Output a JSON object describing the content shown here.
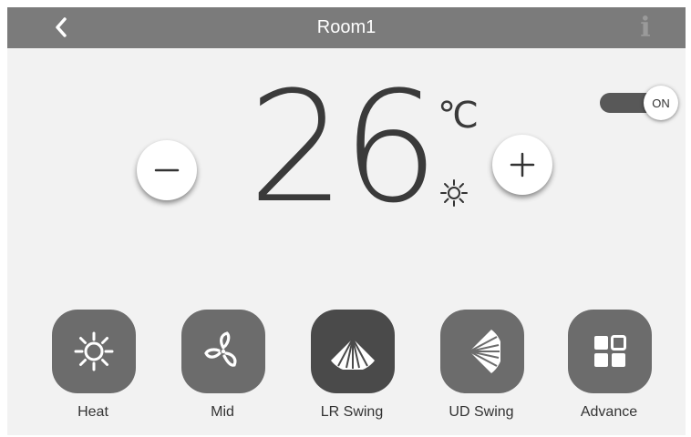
{
  "header": {
    "title": "Room1",
    "back_icon": "chevron-left-icon",
    "info_icon": "info-icon",
    "info_glyph": "i"
  },
  "temperature": {
    "value": "26",
    "unit": "℃",
    "mode_icon": "sun-icon"
  },
  "controls": {
    "decrease_icon": "minus-icon",
    "increase_icon": "plus-icon"
  },
  "power": {
    "label": "ON",
    "state": true
  },
  "functions": [
    {
      "label": "Heat",
      "icon": "sun-icon"
    },
    {
      "label": "Mid",
      "icon": "fan-icon"
    },
    {
      "label": "LR Swing",
      "icon": "lr-swing-icon"
    },
    {
      "label": "UD Swing",
      "icon": "ud-swing-icon"
    },
    {
      "label": "Advance",
      "icon": "grid-icon"
    }
  ],
  "colors": {
    "header_bg": "#7b7b7b",
    "panel_bg": "#f2f2f2",
    "button_bg": "#6c6c6c",
    "button_active_bg": "#4a4a4a",
    "toggle_track": "#585858",
    "text": "#3a3a3a"
  }
}
